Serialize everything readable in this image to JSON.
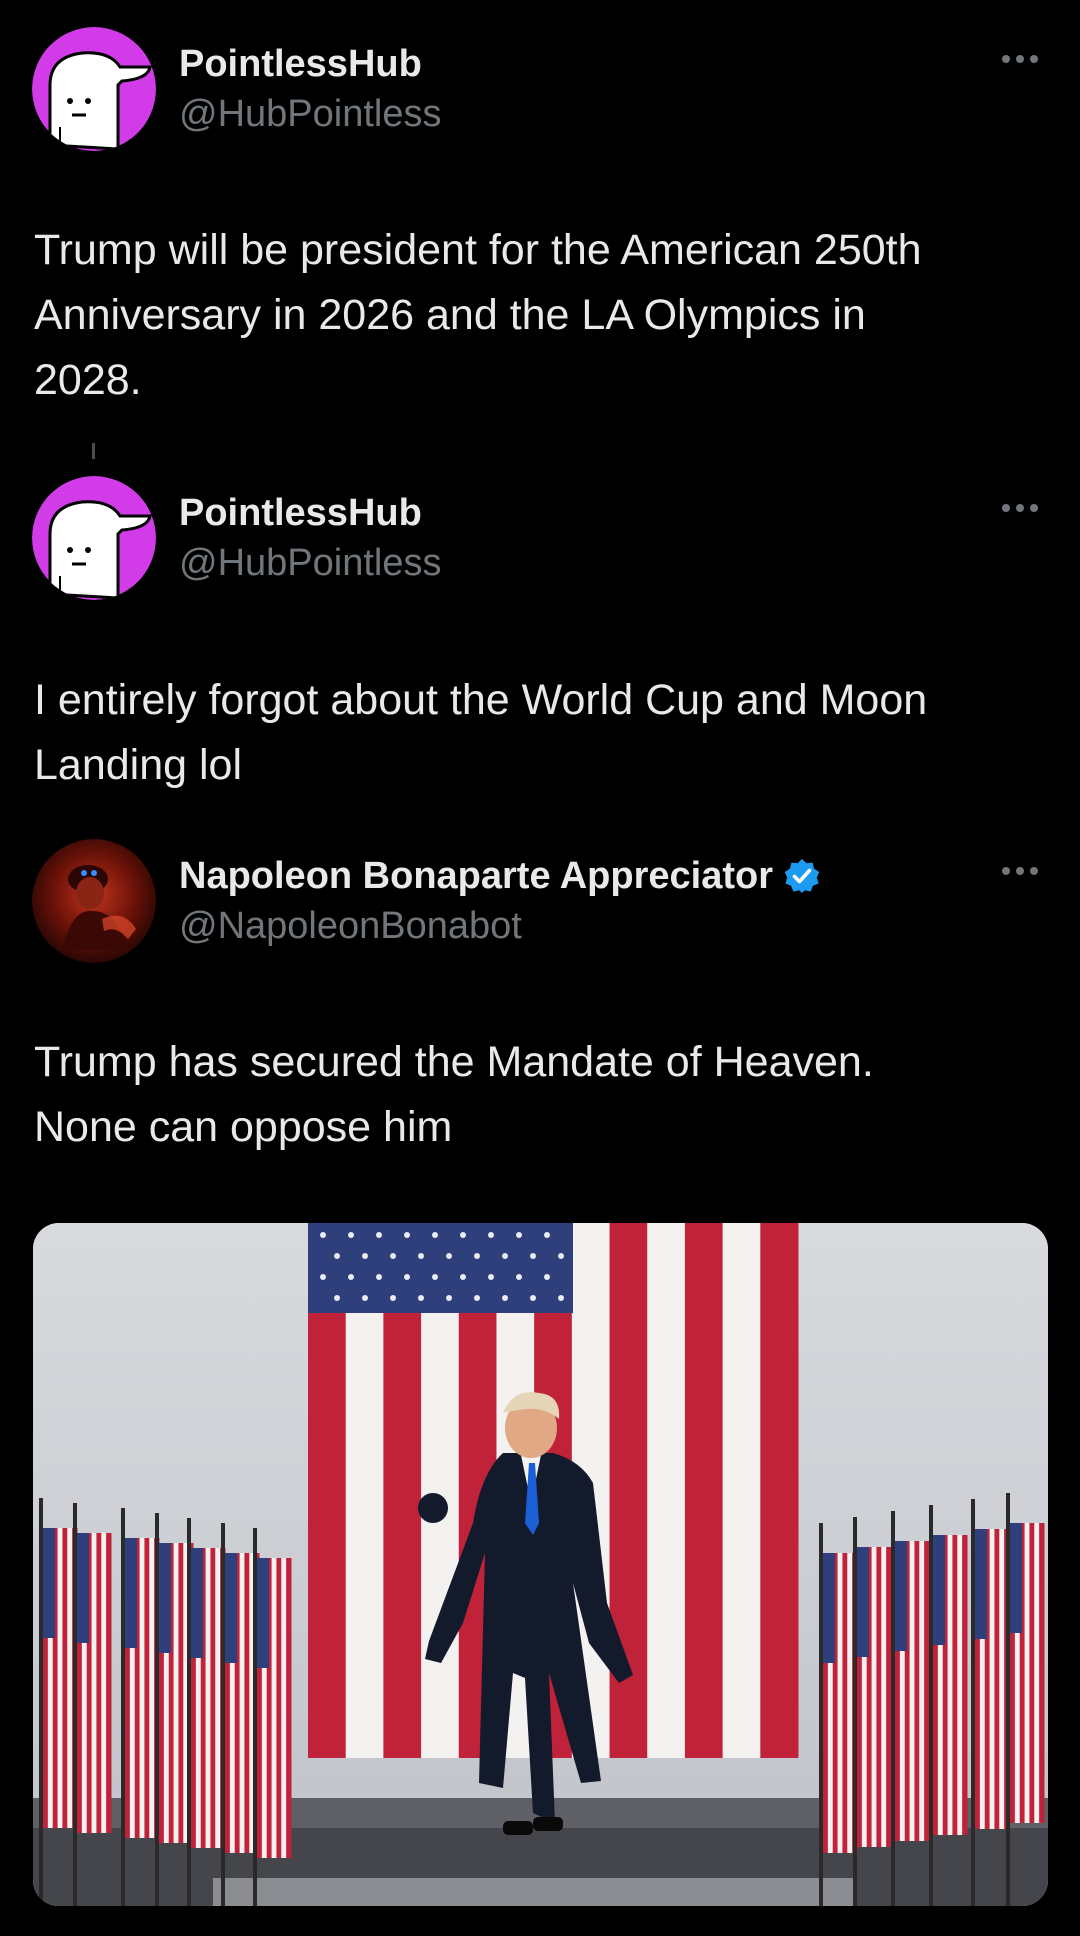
{
  "posts": [
    {
      "display_name": "PointlessHub",
      "handle": "@HubPointless",
      "avatar_icon": "cartoon-face-cap-avatar",
      "text_lines": [
        "Trump will be president for the American 250th",
        "Anniversary in 2026 and the LA Olympics in",
        "2028."
      ]
    },
    {
      "display_name": "PointlessHub",
      "handle": "@HubPointless",
      "avatar_icon": "cartoon-face-cap-avatar",
      "text_lines": [
        "I entirely forgot about the World Cup and Moon",
        "Landing lol"
      ]
    },
    {
      "display_name": "Napoleon Bonaparte Appreciator",
      "handle": "@NapoleonBonabot",
      "verified": true,
      "avatar_icon": "red-dark-portrait-avatar",
      "text_lines": [
        "Trump has secured the Mandate of Heaven.",
        "None can oppose him"
      ],
      "media": {
        "type": "photo",
        "alt_icon": "flag-rally-photo"
      }
    }
  ],
  "colors": {
    "background": "#000000",
    "text": "#e7e9ea",
    "secondary": "#71767b",
    "verified": "#1d9bf0",
    "avatar_purple": "#d13be8"
  }
}
